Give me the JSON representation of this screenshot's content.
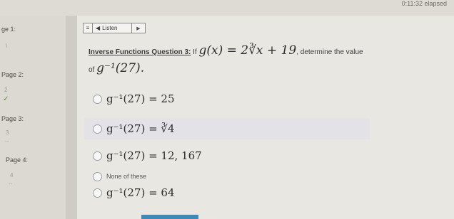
{
  "header": {
    "elapsed": "0:11:32 elapsed"
  },
  "sidebar": {
    "pages": [
      {
        "label": "ge 1:",
        "mark": "\\",
        "checked": false
      },
      {
        "label": "Page 2:",
        "mark": "2",
        "checked": true
      },
      {
        "label": "Page 3:",
        "mark": "3",
        "checked": false
      },
      {
        "label": "Page 4:",
        "mark": "4",
        "checked": false
      }
    ],
    "check_glyph": "✓",
    "dash_glyph": "--"
  },
  "toolbar": {
    "menu_icon": "≡",
    "speaker_icon": "◀",
    "listen_label": "Listen",
    "play_icon": "▶"
  },
  "question": {
    "title": "Inverse Functions Question 3:",
    "prefix": "If",
    "function": "g(x) = 2∛x + 19",
    "suffix": ", determine the value",
    "of_label": "of",
    "target": "g⁻¹(27)."
  },
  "options": [
    {
      "text": "g⁻¹(27) = 25"
    },
    {
      "text": "g⁻¹(27) = ∛4"
    },
    {
      "text": "g⁻¹(27) = 12, 167"
    },
    {
      "text": "None of these"
    },
    {
      "text": "g⁻¹(27) = 64"
    }
  ]
}
